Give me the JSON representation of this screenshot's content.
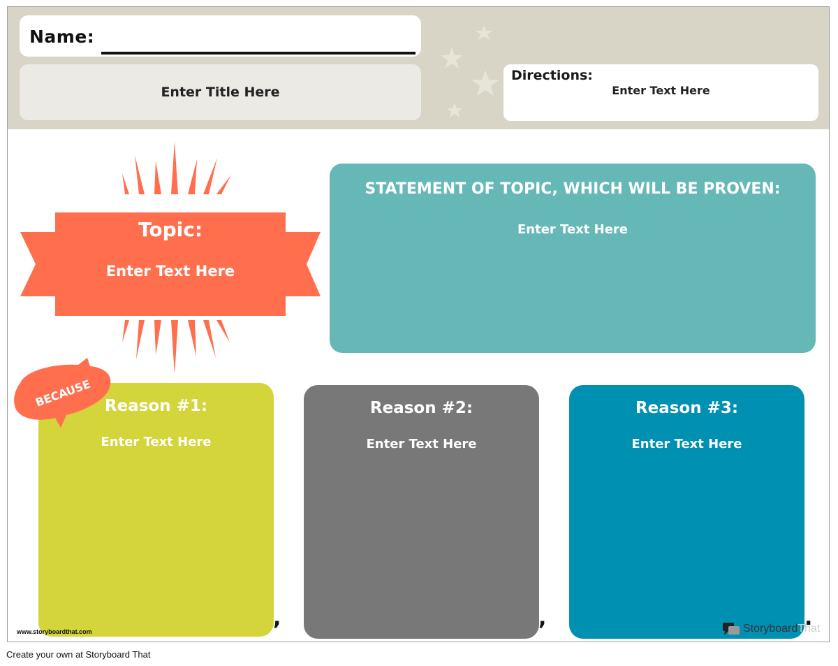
{
  "header": {
    "name_label": "Name:",
    "title_placeholder": "Enter Title Here",
    "directions_label": "Directions:",
    "directions_text": "Enter Text Here"
  },
  "topic": {
    "label": "Topic:",
    "text": "Enter Text Here",
    "color": "#ff6f4e"
  },
  "statement": {
    "heading": "STATEMENT OF TOPIC, WHICH WILL BE PROVEN:",
    "text": "Enter Text Here",
    "color": "#66b8b7"
  },
  "because_label": "BECAUSE",
  "reasons": [
    {
      "title": "Reason #1:",
      "text": "Enter Text Here",
      "color": "#d3d53a",
      "trailing_punct": ","
    },
    {
      "title": "Reason #2:",
      "text": "Enter Text Here",
      "color": "#787878",
      "trailing_punct": ","
    },
    {
      "title": "Reason #3:",
      "text": "Enter Text Here",
      "color": "#0090b2",
      "trailing_punct": "."
    }
  ],
  "footer": {
    "website": "www.storyboardthat.com",
    "logo_text_a": "Storyboard",
    "logo_text_b": "That",
    "caption": "Create your own at Storyboard That"
  }
}
